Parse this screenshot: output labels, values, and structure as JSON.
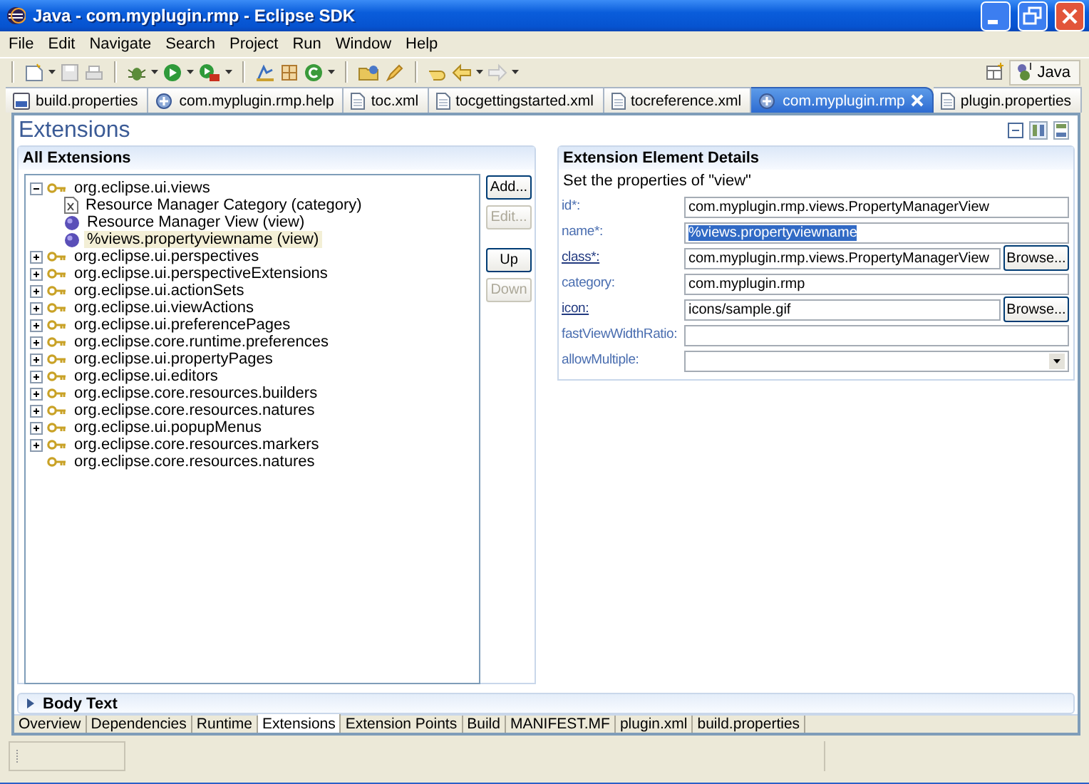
{
  "window": {
    "title": "Java - com.myplugin.rmp - Eclipse SDK"
  },
  "menu": [
    "File",
    "Edit",
    "Navigate",
    "Search",
    "Project",
    "Run",
    "Window",
    "Help"
  ],
  "perspective": {
    "label": "Java"
  },
  "editor_tabs": [
    {
      "label": "build.properties",
      "kind": "build",
      "selected": false
    },
    {
      "label": "com.myplugin.rmp.help",
      "kind": "plugin",
      "selected": false
    },
    {
      "label": "toc.xml",
      "kind": "file",
      "selected": false
    },
    {
      "label": "tocgettingstarted.xml",
      "kind": "file",
      "selected": false
    },
    {
      "label": "tocreference.xml",
      "kind": "file",
      "selected": false
    },
    {
      "label": "com.myplugin.rmp",
      "kind": "plugin",
      "selected": true
    },
    {
      "label": "plugin.properties",
      "kind": "file",
      "selected": false
    }
  ],
  "form": {
    "title": "Extensions"
  },
  "extensions": {
    "title": "All Extensions",
    "tree": [
      {
        "label": "org.eclipse.ui.views",
        "expandable": true,
        "expanded": true,
        "children": [
          {
            "label": "Resource Manager Category (category)",
            "kind": "category",
            "selected": false
          },
          {
            "label": "Resource Manager View (view)",
            "kind": "view",
            "selected": false
          },
          {
            "label": "%views.propertyviewname (view)",
            "kind": "view",
            "selected": true
          }
        ]
      },
      {
        "label": "org.eclipse.ui.perspectives",
        "expandable": true,
        "expanded": false
      },
      {
        "label": "org.eclipse.ui.perspectiveExtensions",
        "expandable": true,
        "expanded": false
      },
      {
        "label": "org.eclipse.ui.actionSets",
        "expandable": true,
        "expanded": false
      },
      {
        "label": "org.eclipse.ui.viewActions",
        "expandable": true,
        "expanded": false
      },
      {
        "label": "org.eclipse.ui.preferencePages",
        "expandable": true,
        "expanded": false
      },
      {
        "label": "org.eclipse.core.runtime.preferences",
        "expandable": true,
        "expanded": false
      },
      {
        "label": "org.eclipse.ui.propertyPages",
        "expandable": true,
        "expanded": false
      },
      {
        "label": "org.eclipse.ui.editors",
        "expandable": true,
        "expanded": false
      },
      {
        "label": "org.eclipse.core.resources.builders",
        "expandable": true,
        "expanded": false
      },
      {
        "label": "org.eclipse.core.resources.natures",
        "expandable": true,
        "expanded": false
      },
      {
        "label": "org.eclipse.ui.popupMenus",
        "expandable": true,
        "expanded": false
      },
      {
        "label": "org.eclipse.core.resources.markers",
        "expandable": true,
        "expanded": false
      },
      {
        "label": "org.eclipse.core.resources.natures",
        "expandable": false
      }
    ],
    "buttons": [
      {
        "label": "Add...",
        "disabled": false
      },
      {
        "label": "Edit...",
        "disabled": true
      },
      {
        "label": "Up",
        "disabled": false
      },
      {
        "label": "Down",
        "disabled": true
      }
    ]
  },
  "details": {
    "title": "Extension Element Details",
    "description": "Set the properties of \"view\"",
    "fields": [
      {
        "label": "id*:",
        "kind": "text",
        "link": false,
        "value": "com.myplugin.rmp.views.PropertyManagerView",
        "highlighted": false
      },
      {
        "label": "name*:",
        "kind": "text",
        "link": false,
        "value": "%views.propertyviewname",
        "highlighted": true
      },
      {
        "label": "class*:",
        "kind": "text",
        "link": true,
        "value": "com.myplugin.rmp.views.PropertyManagerView",
        "highlighted": false,
        "browse": "Browse..."
      },
      {
        "label": "category:",
        "kind": "text",
        "link": false,
        "value": "com.myplugin.rmp",
        "highlighted": false
      },
      {
        "label": "icon:",
        "kind": "text",
        "link": true,
        "value": "icons/sample.gif",
        "highlighted": false,
        "browse": "Browse..."
      },
      {
        "label": "fastViewWidthRatio:",
        "kind": "text",
        "link": false,
        "highlighted": false
      },
      {
        "label": "allowMultiple:",
        "kind": "combo",
        "link": false,
        "highlighted": false
      }
    ]
  },
  "body_text": {
    "title": "Body Text",
    "expanded": false
  },
  "page_tabs": [
    {
      "label": "Overview",
      "selected": false
    },
    {
      "label": "Dependencies",
      "selected": false
    },
    {
      "label": "Runtime",
      "selected": false
    },
    {
      "label": "Extensions",
      "selected": true
    },
    {
      "label": "Extension Points",
      "selected": false
    },
    {
      "label": "Build",
      "selected": false
    },
    {
      "label": "MANIFEST.MF",
      "selected": false
    },
    {
      "label": "plugin.xml",
      "selected": false
    },
    {
      "label": "build.properties",
      "selected": false
    }
  ]
}
